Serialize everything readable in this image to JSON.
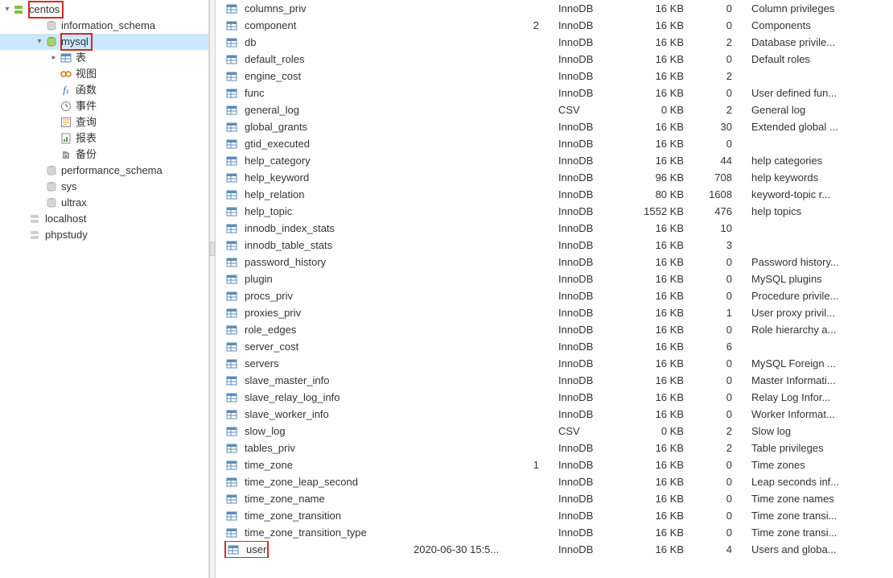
{
  "tree": {
    "root": "centos",
    "root_highlight": true,
    "items": [
      {
        "depth": 1,
        "label": "information_schema",
        "icon": "db"
      },
      {
        "depth": 1,
        "label": "mysql",
        "icon": "db-active",
        "expanded": true,
        "selected": true,
        "highlight": true
      },
      {
        "depth": 2,
        "label": "表",
        "icon": "table",
        "expandable": true
      },
      {
        "depth": 2,
        "label": "视图",
        "icon": "view"
      },
      {
        "depth": 2,
        "label": "函数",
        "icon": "fx"
      },
      {
        "depth": 2,
        "label": "事件",
        "icon": "event"
      },
      {
        "depth": 2,
        "label": "查询",
        "icon": "query"
      },
      {
        "depth": 2,
        "label": "报表",
        "icon": "report"
      },
      {
        "depth": 2,
        "label": "备份",
        "icon": "backup"
      },
      {
        "depth": 1,
        "label": "performance_schema",
        "icon": "db"
      },
      {
        "depth": 1,
        "label": "sys",
        "icon": "db"
      },
      {
        "depth": 1,
        "label": "ultrax",
        "icon": "db"
      },
      {
        "depth": 0,
        "label": "localhost",
        "icon": "server-off"
      },
      {
        "depth": 0,
        "label": "phpstudy",
        "icon": "server-off"
      }
    ]
  },
  "tables": [
    {
      "name": "columns_priv",
      "date": "",
      "engine": "InnoDB",
      "size": "16 KB",
      "rows": 0,
      "comment": "Column privileges"
    },
    {
      "name": "component",
      "date": "",
      "engine": "InnoDB",
      "size": "16 KB",
      "rows": 0,
      "comment": "Components",
      "extra": "2"
    },
    {
      "name": "db",
      "date": "",
      "engine": "InnoDB",
      "size": "16 KB",
      "rows": 2,
      "comment": "Database privile..."
    },
    {
      "name": "default_roles",
      "date": "",
      "engine": "InnoDB",
      "size": "16 KB",
      "rows": 0,
      "comment": "Default roles"
    },
    {
      "name": "engine_cost",
      "date": "",
      "engine": "InnoDB",
      "size": "16 KB",
      "rows": 2,
      "comment": ""
    },
    {
      "name": "func",
      "date": "",
      "engine": "InnoDB",
      "size": "16 KB",
      "rows": 0,
      "comment": "User defined fun..."
    },
    {
      "name": "general_log",
      "date": "",
      "engine": "CSV",
      "size": "0 KB",
      "rows": 2,
      "comment": "General log"
    },
    {
      "name": "global_grants",
      "date": "",
      "engine": "InnoDB",
      "size": "16 KB",
      "rows": 30,
      "comment": "Extended global ..."
    },
    {
      "name": "gtid_executed",
      "date": "",
      "engine": "InnoDB",
      "size": "16 KB",
      "rows": 0,
      "comment": ""
    },
    {
      "name": "help_category",
      "date": "",
      "engine": "InnoDB",
      "size": "16 KB",
      "rows": 44,
      "comment": "help categories"
    },
    {
      "name": "help_keyword",
      "date": "",
      "engine": "InnoDB",
      "size": "96 KB",
      "rows": 708,
      "comment": "help keywords"
    },
    {
      "name": "help_relation",
      "date": "",
      "engine": "InnoDB",
      "size": "80 KB",
      "rows": 1608,
      "comment": "keyword-topic r..."
    },
    {
      "name": "help_topic",
      "date": "",
      "engine": "InnoDB",
      "size": "1552 KB",
      "rows": 476,
      "comment": "help topics"
    },
    {
      "name": "innodb_index_stats",
      "date": "",
      "engine": "InnoDB",
      "size": "16 KB",
      "rows": 10,
      "comment": ""
    },
    {
      "name": "innodb_table_stats",
      "date": "",
      "engine": "InnoDB",
      "size": "16 KB",
      "rows": 3,
      "comment": ""
    },
    {
      "name": "password_history",
      "date": "",
      "engine": "InnoDB",
      "size": "16 KB",
      "rows": 0,
      "comment": "Password history..."
    },
    {
      "name": "plugin",
      "date": "",
      "engine": "InnoDB",
      "size": "16 KB",
      "rows": 0,
      "comment": "MySQL plugins"
    },
    {
      "name": "procs_priv",
      "date": "",
      "engine": "InnoDB",
      "size": "16 KB",
      "rows": 0,
      "comment": "Procedure privile..."
    },
    {
      "name": "proxies_priv",
      "date": "",
      "engine": "InnoDB",
      "size": "16 KB",
      "rows": 1,
      "comment": "User proxy privil..."
    },
    {
      "name": "role_edges",
      "date": "",
      "engine": "InnoDB",
      "size": "16 KB",
      "rows": 0,
      "comment": "Role hierarchy a..."
    },
    {
      "name": "server_cost",
      "date": "",
      "engine": "InnoDB",
      "size": "16 KB",
      "rows": 6,
      "comment": ""
    },
    {
      "name": "servers",
      "date": "",
      "engine": "InnoDB",
      "size": "16 KB",
      "rows": 0,
      "comment": "MySQL Foreign ..."
    },
    {
      "name": "slave_master_info",
      "date": "",
      "engine": "InnoDB",
      "size": "16 KB",
      "rows": 0,
      "comment": "Master Informati..."
    },
    {
      "name": "slave_relay_log_info",
      "date": "",
      "engine": "InnoDB",
      "size": "16 KB",
      "rows": 0,
      "comment": "Relay Log Infor..."
    },
    {
      "name": "slave_worker_info",
      "date": "",
      "engine": "InnoDB",
      "size": "16 KB",
      "rows": 0,
      "comment": "Worker Informat..."
    },
    {
      "name": "slow_log",
      "date": "",
      "engine": "CSV",
      "size": "0 KB",
      "rows": 2,
      "comment": "Slow log"
    },
    {
      "name": "tables_priv",
      "date": "",
      "engine": "InnoDB",
      "size": "16 KB",
      "rows": 2,
      "comment": "Table privileges"
    },
    {
      "name": "time_zone",
      "date": "",
      "engine": "InnoDB",
      "size": "16 KB",
      "rows": 0,
      "comment": "Time zones",
      "extra": "1"
    },
    {
      "name": "time_zone_leap_second",
      "date": "",
      "engine": "InnoDB",
      "size": "16 KB",
      "rows": 0,
      "comment": "Leap seconds inf..."
    },
    {
      "name": "time_zone_name",
      "date": "",
      "engine": "InnoDB",
      "size": "16 KB",
      "rows": 0,
      "comment": "Time zone names"
    },
    {
      "name": "time_zone_transition",
      "date": "",
      "engine": "InnoDB",
      "size": "16 KB",
      "rows": 0,
      "comment": "Time zone transi..."
    },
    {
      "name": "time_zone_transition_type",
      "date": "",
      "engine": "InnoDB",
      "size": "16 KB",
      "rows": 0,
      "comment": "Time zone transi..."
    },
    {
      "name": "user",
      "date": "2020-06-30 15:5...",
      "engine": "InnoDB",
      "size": "16 KB",
      "rows": 4,
      "comment": "Users and globa...",
      "highlight": true
    }
  ]
}
